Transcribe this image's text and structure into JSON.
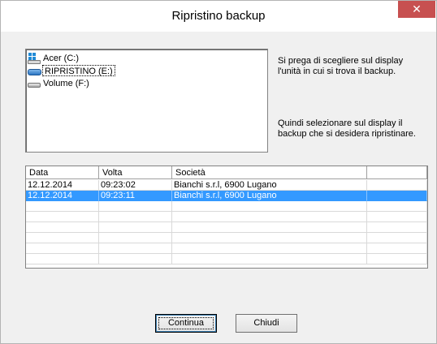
{
  "window": {
    "title": "Ripristino backup",
    "close_glyph": "✕"
  },
  "drives": [
    {
      "label": "Acer (C:)",
      "icon": "windows-drive-icon",
      "selected": false
    },
    {
      "label": "RIPRISTINO (E:)",
      "icon": "removable-drive-icon",
      "selected": true
    },
    {
      "label": "Volume (F:)",
      "icon": "hard-drive-icon",
      "selected": false
    }
  ],
  "instructions": {
    "line1": "Si prega di scegliere sul display l'unità in cui si trova il backup.",
    "line2": "Quindi selezionare sul display il backup che si desidera ripristinare."
  },
  "grid": {
    "columns": [
      "Data",
      "Volta",
      "Società",
      ""
    ],
    "rows": [
      {
        "data": "12.12.2014",
        "volta": "09:23:02",
        "societa": "Bianchi s.r.l, 6900 Lugano",
        "selected": false
      },
      {
        "data": "12.12.2014",
        "volta": "09:23:11",
        "societa": "Bianchi s.r.l, 6900 Lugano",
        "selected": true
      }
    ]
  },
  "buttons": {
    "continue_label": "Continua",
    "close_label": "Chiudi"
  },
  "colors": {
    "selection": "#3399ff",
    "close_button": "#c75050"
  }
}
